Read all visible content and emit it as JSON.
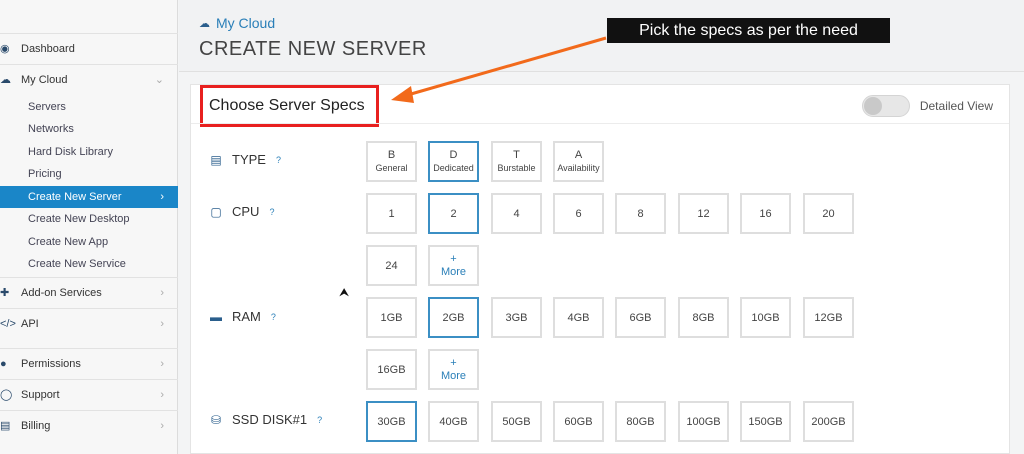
{
  "sidebar": {
    "items": [
      {
        "label": "Dashboard",
        "icon": "dashboard-icon"
      },
      {
        "label": "My Cloud",
        "icon": "cloud-icon"
      }
    ],
    "submenu": [
      {
        "label": "Servers"
      },
      {
        "label": "Networks"
      },
      {
        "label": "Hard Disk Library"
      },
      {
        "label": "Pricing"
      },
      {
        "label": "Create New Server",
        "active": true
      },
      {
        "label": "Create New Desktop"
      },
      {
        "label": "Create New App"
      },
      {
        "label": "Create New Service"
      }
    ],
    "bottom_items": [
      {
        "label": "Add-on Services",
        "icon": "addon-icon"
      },
      {
        "label": "API",
        "icon": "code-icon"
      },
      {
        "label": "Permissions",
        "icon": "users-icon"
      },
      {
        "label": "Support",
        "icon": "support-icon"
      },
      {
        "label": "Billing",
        "icon": "billing-icon"
      }
    ]
  },
  "header": {
    "breadcrumb": "My Cloud",
    "title": "CREATE NEW SERVER"
  },
  "annotation": {
    "text": "Pick the specs as per the need"
  },
  "specs": {
    "section_title": "Choose Server Specs",
    "toggle_label": "Detailed View",
    "type": {
      "label": "TYPE",
      "help": "?",
      "options": [
        {
          "letter": "B",
          "name": "General"
        },
        {
          "letter": "D",
          "name": "Dedicated",
          "selected": true
        },
        {
          "letter": "T",
          "name": "Burstable"
        },
        {
          "letter": "A",
          "name": "Availability"
        }
      ]
    },
    "cpu": {
      "label": "CPU",
      "help": "?",
      "options": [
        "1",
        "2",
        "4",
        "6",
        "8",
        "12",
        "16",
        "20",
        "24"
      ],
      "selected": "2",
      "more_plus": "+",
      "more_label": "More"
    },
    "ram": {
      "label": "RAM",
      "help": "?",
      "options": [
        "1GB",
        "2GB",
        "3GB",
        "4GB",
        "6GB",
        "8GB",
        "10GB",
        "12GB",
        "16GB"
      ],
      "selected": "2GB",
      "more_plus": "+",
      "more_label": "More"
    },
    "disk": {
      "label": "SSD DISK#1",
      "help": "?",
      "options": [
        "30GB",
        "40GB",
        "50GB",
        "60GB",
        "80GB",
        "100GB",
        "150GB",
        "200GB"
      ],
      "selected": "30GB"
    }
  },
  "colors": {
    "accent": "#1a86c8",
    "annotation_box": "#e8201f",
    "arrow": "#f26a1b",
    "selected_border": "#3b8fc4"
  }
}
